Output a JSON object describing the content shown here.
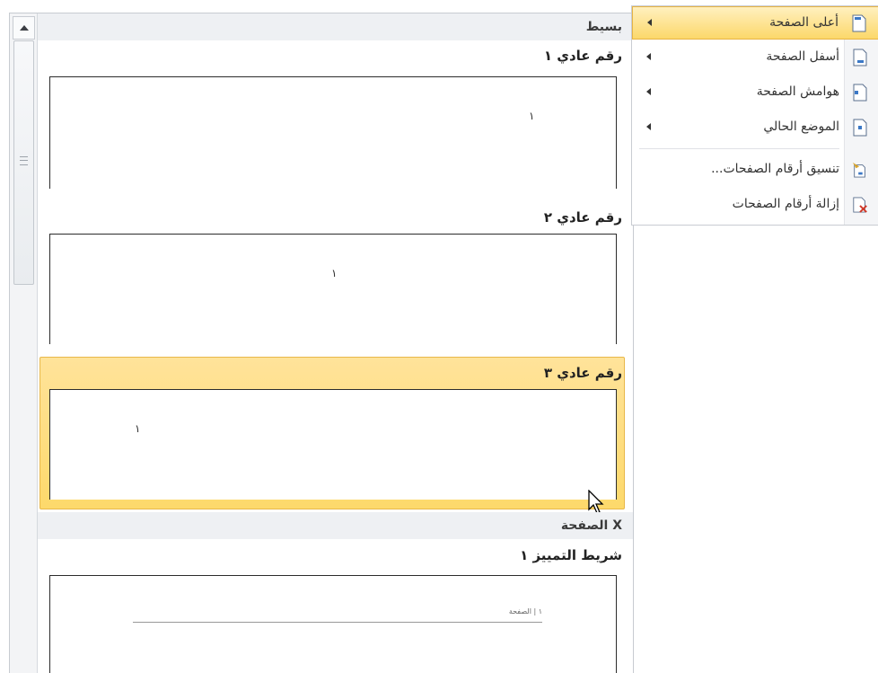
{
  "gallery": {
    "category_simple": "بسيط",
    "item1": {
      "title": "رقم عادي ١",
      "page_number": "١"
    },
    "item2": {
      "title": "رقم عادي ٢",
      "page_number": "١"
    },
    "item3": {
      "title": "رقم عادي ٣",
      "page_number": "١"
    },
    "category_page_x": "الصفحة X",
    "item4": {
      "title": "شريط التمييز ١",
      "page_text": "١ | الصفحة"
    }
  },
  "menu": {
    "items": [
      {
        "label": "أعلى الصفحة",
        "icon": "page-top-icon",
        "has_submenu": true,
        "active": true
      },
      {
        "label": "أسفل الصفحة",
        "icon": "page-bottom-icon",
        "has_submenu": true,
        "active": false
      },
      {
        "label": "هوامش الصفحة",
        "icon": "page-margins-icon",
        "has_submenu": true,
        "active": false
      },
      {
        "label": "الموضع الحالي",
        "icon": "current-position-icon",
        "has_submenu": true,
        "active": false
      },
      {
        "label": "تنسيق أرقام الصفحات...",
        "icon": "format-page-numbers-icon",
        "has_submenu": false,
        "active": false
      },
      {
        "label": "إزالة أرقام الصفحات",
        "icon": "remove-page-numbers-icon",
        "has_submenu": false,
        "active": false
      }
    ]
  },
  "colors": {
    "hover_fill": "#fdd96b",
    "hover_border": "#e8b84a",
    "header_bg": "#eef0f3"
  }
}
